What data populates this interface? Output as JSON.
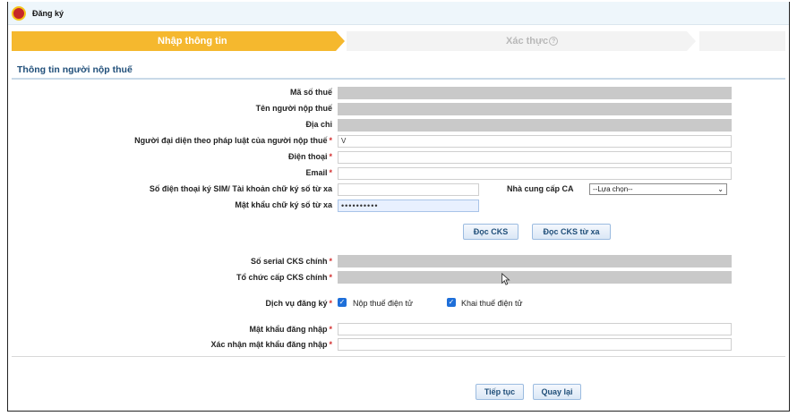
{
  "titlebar": {
    "title": "Đăng ký"
  },
  "stepper": {
    "step1": "Nhập thông tin",
    "step2": "Xác thực"
  },
  "section": {
    "title": "Thông tin người nộp thuế"
  },
  "form": {
    "tax_code_label": "Mã số thuế",
    "taxpayer_name_label": "Tên người nộp thuế",
    "address_label": "Địa chỉ",
    "legal_rep_label": "Người đại diện theo pháp luật của người nộp thuế",
    "legal_rep_value": "V",
    "phone_label": "Điện thoại",
    "email_label": "Email",
    "remote_sign_phone_label": "Số điện thoại ký SIM/ Tài khoản chữ ký số từ xa",
    "ca_provider_label": "Nhà cung cấp CA",
    "ca_provider_selected": "--Lựa chọn--",
    "remote_sign_password_label": "Mật khẩu chữ ký số từ xa",
    "remote_sign_password_value": "••••••••••",
    "read_cks_button": "Đọc CKS",
    "read_remote_cks_button": "Đọc CKS từ xa",
    "cert_serial_label": "Số serial CKS chính",
    "cert_issuer_label": "Tổ chức cấp CKS chính",
    "service_label": "Dịch vụ đăng ký",
    "service_option1": "Nộp thuế điện tử",
    "service_option2": "Khai thuế điện tử",
    "login_password_label": "Mật khẩu đăng nhập",
    "confirm_password_label": "Xác nhận mật khẩu đăng nhập",
    "required_mark": "*",
    "checkmark": "✓"
  },
  "actions": {
    "continue_button": "Tiếp tục",
    "back_button": "Quay lại"
  },
  "colors": {
    "step_active": "#f5b82e",
    "section_title": "#1f4e79",
    "required": "#d32f2f",
    "disabled_field": "#c9c9c9"
  }
}
